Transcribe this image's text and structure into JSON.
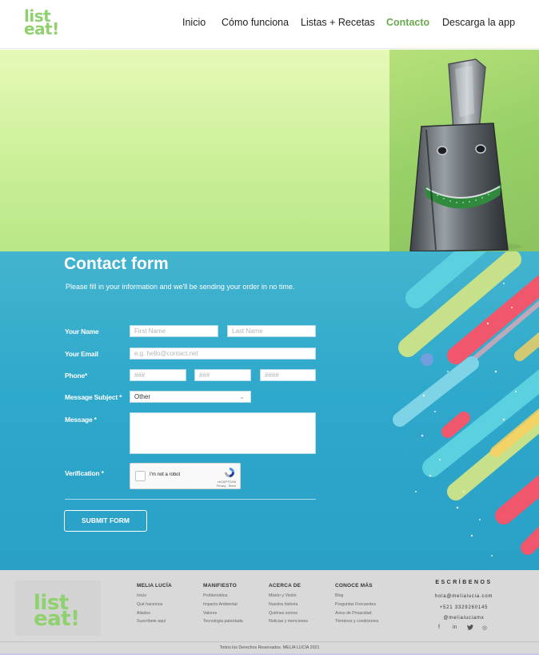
{
  "header": {
    "logo_line1": "list",
    "logo_line2": "eat!",
    "nav": [
      {
        "label": "Inicio",
        "active": false
      },
      {
        "label": "Cómo funciona",
        "active": false
      },
      {
        "label": "Listas + Recetas",
        "active": false
      },
      {
        "label": "Contacto",
        "active": true
      },
      {
        "label": "Descarga la app",
        "active": false
      }
    ]
  },
  "form": {
    "title": "Contact form",
    "subtitle": "Please fill in your information and we'll be sending your order in no time.",
    "name_label": "Your Name",
    "first_name_placeholder": "First Name",
    "last_name_placeholder": "Last Name",
    "email_label": "Your Email",
    "email_placeholder": "e.g. hello@contact.net",
    "phone_label": "Phone*",
    "phone_1_placeholder": "###",
    "phone_2_placeholder": "###",
    "phone_3_placeholder": "####",
    "subject_label": "Message Subject *",
    "subject_value": "Other",
    "message_label": "Message *",
    "verification_label": "Verification *",
    "captcha_text": "I'm not a robot",
    "captcha_brand": "reCAPTCHA",
    "captcha_links": "Privacy - Terms",
    "submit_label": "SUBMIT FORM"
  },
  "footer": {
    "logo_line1": "list",
    "logo_line2": "eat!",
    "columns": [
      {
        "heading": "MELIA LUCÍA",
        "items": [
          "Inicio",
          "Qué hacemos",
          "Aliados",
          "Suscríbete aquí"
        ]
      },
      {
        "heading": "MANIFIESTO",
        "items": [
          "Problemática",
          "Impacto Ambiental",
          "Valores",
          "Tecnología patentada"
        ]
      },
      {
        "heading": "ACERCA DE",
        "items": [
          "Misión y Visión",
          "Nuestra historia",
          "Quiénes somos",
          "Noticias y menciones"
        ]
      },
      {
        "heading": "CONOCE MÁS",
        "items": [
          "Blog",
          "Preguntas Frecuentes",
          "Aviso de Privacidad",
          "Términos y condiciones"
        ]
      }
    ],
    "contact_heading": "ESCRÍBENOS",
    "email": "hola@melialucia.com",
    "phone": "+521 3329260145",
    "handle": "@melialuciamx",
    "social": [
      {
        "icon": "facebook-icon",
        "glyph": "f"
      },
      {
        "icon": "linkedin-icon",
        "glyph": "in"
      },
      {
        "icon": "twitter-icon",
        "glyph": "🐦"
      },
      {
        "icon": "instagram-icon",
        "glyph": "◎"
      }
    ],
    "copyright": "Todos los Derechos Reservados. MELIA LUCÍA 2021"
  },
  "colors": {
    "brand_green": "#8fd16e",
    "active_nav": "#6aa84f",
    "form_blue": "#2ea8cb"
  }
}
